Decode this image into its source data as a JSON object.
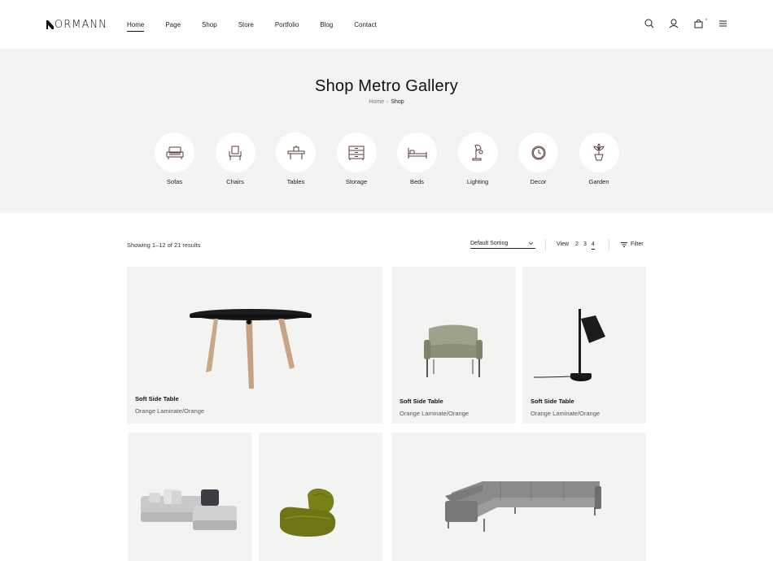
{
  "header": {
    "logo_text": "ORMANN",
    "nav": [
      "Home",
      "Page",
      "Shop",
      "Store",
      "Portfolio",
      "Blog",
      "Contact"
    ],
    "active_nav": "Home",
    "cart_count": "0",
    "icons": [
      "search-icon",
      "user-icon",
      "cart-icon",
      "menu-icon"
    ]
  },
  "hero": {
    "title": "Shop Metro Gallery",
    "breadcrumb": {
      "home": "Home",
      "separator": "›",
      "current": "Shop"
    },
    "categories": [
      "Sofas",
      "Chairs",
      "Tables",
      "Storage",
      "Beds",
      "Lighting",
      "Decor",
      "Garden"
    ]
  },
  "toolbar": {
    "result_count": "Showing 1–12 of 21 results",
    "sorting": "Default Sorting",
    "view_label": "View",
    "view_options": [
      "2",
      "3",
      "4"
    ],
    "view_active": "4",
    "filter_label": "Filter"
  },
  "products": [
    {
      "title": "Soft Side Table",
      "subtitle": "Orange Laminate/Orange",
      "image": "round-side-table"
    },
    {
      "title": "Soft Side Table",
      "subtitle": "Orange Laminate/Orange",
      "image": "armchair"
    },
    {
      "title": "Soft Side Table",
      "subtitle": "Orange Laminate/Orange",
      "image": "desk-lamp"
    },
    {
      "title": "",
      "subtitle": "",
      "image": "modular-sofa"
    },
    {
      "title": "",
      "subtitle": "",
      "image": "lounge-chair"
    },
    {
      "title": "",
      "subtitle": "",
      "image": "corner-sofa"
    }
  ],
  "colors": {
    "hero_bg": "#f3f3f1",
    "card_bg": "#f3f3f1",
    "icon_stroke": "#5a3a3a",
    "text": "#111111"
  }
}
